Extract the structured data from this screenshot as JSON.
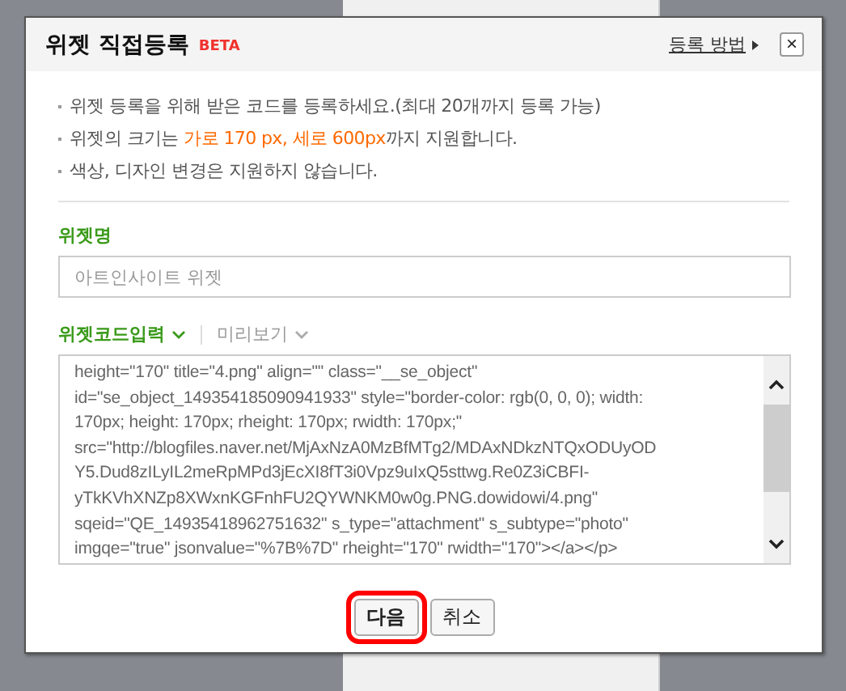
{
  "dialog": {
    "title": "위젯 직접등록",
    "badge": "BETA",
    "help_link": "등록 방법",
    "close_label": "×"
  },
  "notes": [
    {
      "segments": [
        {
          "text": "위젯 등록을 위해 받은 코드를 등록하세요.(최대 20개까지 등록 가능)",
          "highlight": false
        }
      ]
    },
    {
      "segments": [
        {
          "text": "위젯의 크기는 ",
          "highlight": false
        },
        {
          "text": "가로 170 px, 세로 600px",
          "highlight": true
        },
        {
          "text": "까지 지원합니다.",
          "highlight": false
        }
      ]
    },
    {
      "segments": [
        {
          "text": "색상, 디자인 변경은 지원하지 않습니다.",
          "highlight": false
        }
      ]
    }
  ],
  "name_field": {
    "label": "위젯명",
    "placeholder": "아트인사이트 위젯"
  },
  "code_tabs": [
    {
      "label": "위젯코드입력",
      "selected": true
    },
    {
      "label": "미리보기",
      "selected": false
    }
  ],
  "code_lines": [
    "height=\"170\" title=\"4.png\" align=\"\" class=\"__se_object\"",
    "id=\"se_object_149354185090941933\" style=\"border-color: rgb(0, 0, 0); width:",
    "170px; height: 170px; rheight: 170px; rwidth: 170px;\"",
    "src=\"http://blogfiles.naver.net/MjAxNzA0MzBfMTg2/MDAxNDkzNTQxODUyOD",
    "Y5.Dud8zILyIL2meRpMPd3jEcXI8fT3i0Vpz9uIxQ5sttwg.Re0Z3iCBFI-",
    "yTkKVhXNZp8XWxnKGFnhFU2QYWNKM0w0g.PNG.dowidowi/4.png\"",
    "sqeid=\"QE_14935418962751632\" s_type=\"attachment\" s_subtype=\"photo\"",
    "imgqe=\"true\" jsonvalue=\"%7B%7D\" rheight=\"170\" rwidth=\"170\"></a></p>"
  ],
  "buttons": [
    {
      "label": "다음",
      "highlighted": true
    },
    {
      "label": "취소",
      "highlighted": false
    }
  ]
}
